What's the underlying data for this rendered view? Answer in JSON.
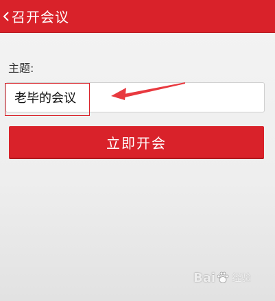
{
  "header": {
    "title": "召开会议",
    "back_icon": "chevron-left-icon"
  },
  "form": {
    "topic_label": "主题:",
    "topic_value": "老毕的会议"
  },
  "actions": {
    "start_label": "立即开会"
  },
  "annotation": {
    "arrow_color": "#e8393f",
    "box_color": "#d9242c"
  },
  "watermark": {
    "brand_text_left": "Bai",
    "brand_text_right": "经验"
  },
  "colors": {
    "accent": "#d9222a",
    "background": "#eeeeee"
  }
}
